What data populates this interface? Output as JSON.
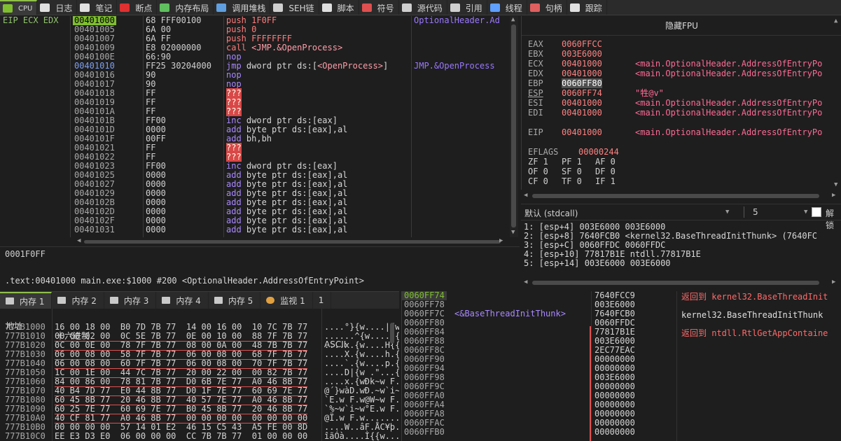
{
  "tabs": [
    {
      "label": "CPU",
      "icon": "cpu-icon",
      "color": "#7fbf2f"
    },
    {
      "label": "日志",
      "icon": "log-icon",
      "color": "#e0e0e0"
    },
    {
      "label": "笔记",
      "icon": "notes-icon",
      "color": "#e0e0e0"
    },
    {
      "label": "断点",
      "icon": "breakpoint-icon",
      "color": "#e03030"
    },
    {
      "label": "内存布局",
      "icon": "memory-map-icon",
      "color": "#5fbf5f"
    },
    {
      "label": "调用堆栈",
      "icon": "call-stack-icon",
      "color": "#5f9fdf"
    },
    {
      "label": "SEH链",
      "icon": "seh-icon",
      "color": "#cfcfcf"
    },
    {
      "label": "脚本",
      "icon": "script-icon",
      "color": "#e0e0e0"
    },
    {
      "label": "符号",
      "icon": "symbol-icon",
      "color": "#df4f4f"
    },
    {
      "label": "源代码",
      "icon": "source-icon",
      "color": "#cfcfcf"
    },
    {
      "label": "引用",
      "icon": "reference-icon",
      "color": "#cfcfcf"
    },
    {
      "label": "线程",
      "icon": "thread-icon",
      "color": "#5f9fff"
    },
    {
      "label": "句柄",
      "icon": "handle-icon",
      "color": "#e05f5f"
    },
    {
      "label": "跟踪",
      "icon": "trace-icon",
      "color": "#e0e0e0"
    }
  ],
  "disasm": {
    "rows": [
      {
        "reg": "EIP ECX EDX",
        "addr": "00401000",
        "bytes": "68 FFF00100",
        "mnem": [
          {
            "t": "push ",
            "c": "kwc"
          },
          {
            "t": "1F0FF",
            "c": "num"
          }
        ],
        "comment": "OptionalHeader.Ad",
        "cur": true
      },
      {
        "addr": "00401005",
        "bytes": "6A 00",
        "mnem": [
          {
            "t": "push ",
            "c": "kwc"
          },
          {
            "t": "0",
            "c": "num"
          }
        ]
      },
      {
        "addr": "00401007",
        "bytes": "6A FF",
        "mnem": [
          {
            "t": "push ",
            "c": "kwc"
          },
          {
            "t": "FFFFFFFF",
            "c": "num"
          }
        ]
      },
      {
        "addr": "00401009",
        "bytes": "E8 02000000",
        "mnem": [
          {
            "t": "call ",
            "c": "kwc"
          },
          {
            "t": "<JMP.&OpenProcess>",
            "c": "jt"
          }
        ]
      },
      {
        "addr": "0040100E",
        "bytes": "66:90",
        "mnem": [
          {
            "t": "nop",
            "c": "kw"
          }
        ]
      },
      {
        "addr": "00401010",
        "bytes": "FF25 30204000",
        "mnem": [
          {
            "t": "jmp ",
            "c": "kw"
          },
          {
            "t": "dword ptr ds:[",
            "c": "reg"
          },
          {
            "t": "<OpenProcess>",
            "c": "jt"
          },
          {
            "t": "]",
            "c": "reg"
          }
        ],
        "comment": "JMP.&OpenProcess",
        "lbl": true
      },
      {
        "addr": "00401016",
        "bytes": "90",
        "mnem": [
          {
            "t": "nop",
            "c": "kw"
          }
        ]
      },
      {
        "addr": "00401017",
        "bytes": "90",
        "mnem": [
          {
            "t": "nop",
            "c": "kw"
          }
        ]
      },
      {
        "addr": "00401018",
        "bytes": "FF",
        "mnem": [
          {
            "t": "???",
            "c": "bad"
          }
        ]
      },
      {
        "addr": "00401019",
        "bytes": "FF",
        "mnem": [
          {
            "t": "???",
            "c": "bad"
          }
        ]
      },
      {
        "addr": "0040101A",
        "bytes": "FF",
        "mnem": [
          {
            "t": "???",
            "c": "bad"
          }
        ]
      },
      {
        "addr": "0040101B",
        "bytes": "FF00",
        "mnem": [
          {
            "t": "inc ",
            "c": "kw"
          },
          {
            "t": "dword ptr ds:[eax]",
            "c": "reg"
          }
        ]
      },
      {
        "addr": "0040101D",
        "bytes": "0000",
        "mnem": [
          {
            "t": "add ",
            "c": "kw"
          },
          {
            "t": "byte ptr ds:[eax],al",
            "c": "reg"
          }
        ]
      },
      {
        "addr": "0040101F",
        "bytes": "00FF",
        "mnem": [
          {
            "t": "add ",
            "c": "kw"
          },
          {
            "t": "bh,bh",
            "c": "reg"
          }
        ]
      },
      {
        "addr": "00401021",
        "bytes": "FF",
        "mnem": [
          {
            "t": "???",
            "c": "bad"
          }
        ]
      },
      {
        "addr": "00401022",
        "bytes": "FF",
        "mnem": [
          {
            "t": "???",
            "c": "bad"
          }
        ]
      },
      {
        "addr": "00401023",
        "bytes": "FF00",
        "mnem": [
          {
            "t": "inc ",
            "c": "kw"
          },
          {
            "t": "dword ptr ds:[eax]",
            "c": "reg"
          }
        ]
      },
      {
        "addr": "00401025",
        "bytes": "0000",
        "mnem": [
          {
            "t": "add ",
            "c": "kw"
          },
          {
            "t": "byte ptr ds:[eax],al",
            "c": "reg"
          }
        ]
      },
      {
        "addr": "00401027",
        "bytes": "0000",
        "mnem": [
          {
            "t": "add ",
            "c": "kw"
          },
          {
            "t": "byte ptr ds:[eax],al",
            "c": "reg"
          }
        ]
      },
      {
        "addr": "00401029",
        "bytes": "0000",
        "mnem": [
          {
            "t": "add ",
            "c": "kw"
          },
          {
            "t": "byte ptr ds:[eax],al",
            "c": "reg"
          }
        ]
      },
      {
        "addr": "0040102B",
        "bytes": "0000",
        "mnem": [
          {
            "t": "add ",
            "c": "kw"
          },
          {
            "t": "byte ptr ds:[eax],al",
            "c": "reg"
          }
        ]
      },
      {
        "addr": "0040102D",
        "bytes": "0000",
        "mnem": [
          {
            "t": "add ",
            "c": "kw"
          },
          {
            "t": "byte ptr ds:[eax],al",
            "c": "reg"
          }
        ]
      },
      {
        "addr": "0040102F",
        "bytes": "0000",
        "mnem": [
          {
            "t": "add ",
            "c": "kw"
          },
          {
            "t": "byte ptr ds:[eax],al",
            "c": "reg"
          }
        ]
      },
      {
        "addr": "00401031",
        "bytes": "0000",
        "mnem": [
          {
            "t": "add ",
            "c": "kw"
          },
          {
            "t": "byte ptr ds:[eax],al",
            "c": "reg"
          }
        ]
      }
    ]
  },
  "info": {
    "value": "0001F0FF",
    "location": ".text:00401000 main.exe:$1000 #200 <OptionalHeader.AddressOfEntryPoint>"
  },
  "registers": {
    "fpu_button": "隐藏FPU",
    "rows": [
      {
        "name": "EAX",
        "value": "0060FFCC",
        "comment": ""
      },
      {
        "name": "EBX",
        "value": "003E6000",
        "comment": ""
      },
      {
        "name": "ECX",
        "value": "00401000",
        "comment": "<main.OptionalHeader.AddressOfEntryPo"
      },
      {
        "name": "EDX",
        "value": "00401000",
        "comment": "<main.OptionalHeader.AddressOfEntryPo"
      },
      {
        "name": "EBP",
        "value": "0060FF80",
        "comment": "",
        "hl": true
      },
      {
        "name": "ESP",
        "value": "0060FF74",
        "comment": "\"牲@v\"",
        "ul": true
      },
      {
        "name": "ESI",
        "value": "00401000",
        "comment": "<main.OptionalHeader.AddressOfEntryPo"
      },
      {
        "name": "EDI",
        "value": "00401000",
        "comment": "<main.OptionalHeader.AddressOfEntryPo"
      },
      {
        "name": "",
        "value": "",
        "comment": ""
      },
      {
        "name": "EIP",
        "value": "00401000",
        "comment": "<main.OptionalHeader.AddressOfEntryPo"
      },
      {
        "name": "",
        "value": "",
        "comment": ""
      },
      {
        "name": "EFLAGS",
        "value": "00000244",
        "comment": "",
        "wide": true
      }
    ],
    "flags": [
      [
        "ZF 1",
        "PF 1",
        "AF 0"
      ],
      [
        "OF 0",
        "SF 0",
        "DF 0"
      ],
      [
        "CF 0",
        "TF 0",
        "IF 1"
      ]
    ]
  },
  "callconv": {
    "selected": "默认 (stdcall)",
    "count": "5",
    "checkbox_label": "解锁"
  },
  "args": [
    "1: [esp+4] 003E6000 003E6000",
    "2: [esp+8] 7640FCB0 <kernel32.BaseThreadInitThunk> (7640FC",
    "3: [esp+C] 0060FFDC 0060FFDC",
    "4: [esp+10] 77817B1E ntdll.77817B1E",
    "5: [esp+14] 003E6000 003E6000"
  ],
  "dumptabs": [
    {
      "label": "内存 1",
      "active": true
    },
    {
      "label": "内存 2"
    },
    {
      "label": "内存 3"
    },
    {
      "label": "内存 4"
    },
    {
      "label": "内存 5"
    },
    {
      "label": "监视 1",
      "icon": "watch-icon"
    }
  ],
  "dumptab_more": "1",
  "dump": {
    "header": {
      "addr": "地址",
      "hex": "十六进制",
      "ascii": "ASCII"
    },
    "rows": [
      {
        "addr": "777B1000",
        "hex": "16 00 18 00  B0 7D 7B 77  14 00 16 00  10 7C 7B 77",
        "ascii": "....°}{w....|{w"
      },
      {
        "addr": "777B1010",
        "hex": "00 00 02 00  0C 5E 7B 77  0E 00 10 00  88 7F 7B 77",
        "ascii": "......^{w.....{w"
      },
      {
        "addr": "777B1020",
        "hex": "0C 00 0E 00  78 7F 7B 77  08 00 0A 00  48 7B 7B 77",
        "ascii": "....x.{w....H{{w"
      },
      {
        "addr": "777B1030",
        "hex": "06 00 08 00  58 7F 7B 77  06 00 08 00  68 7F 7B 77",
        "ascii": "....X.{w....h.{w"
      },
      {
        "addr": "777B1040",
        "hex": "06 00 08 00  60 7F 7B 77  06 00 08 00  70 7F 7B 77",
        "ascii": "....`.{w....p.{w"
      },
      {
        "addr": "777B1050",
        "hex": "1C 00 1E 00  44 7C 7B 77  20 00 22 00  00 82 7B 77",
        "ascii": "....D|{w .\"...{w"
      },
      {
        "addr": "777B1060",
        "hex": "84 00 86 00  78 81 7B 77  D0 6B 7E 77  A0 46 8B 77",
        "ascii": "....x.{wÐk~w F.w"
      },
      {
        "addr": "777B1070",
        "hex": "40 B4 7D 77  E0 44 8B 77  D0 1F 7E 77  60 69 7E 77",
        "ascii": "@´}wàD.wÐ.~w`i~w"
      },
      {
        "addr": "777B1080",
        "hex": "60 45 8B 77  20 46 8B 77  40 57 7E 77  A0 46 8B 77",
        "ascii": "`E.w F.w@W~w F.w"
      },
      {
        "addr": "777B1090",
        "hex": "60 25 7E 77  60 69 7E 77  B0 45 8B 77  20 46 8B 77",
        "ascii": "`%~w`i~w°E.w F.w"
      },
      {
        "addr": "777B10A0",
        "hex": "40 CF 81 77  A0 46 8B 77  00 00 00 00  00 00 00 00",
        "ascii": "@Ï.w F.w........"
      },
      {
        "addr": "777B10B0",
        "hex": "00 00 00 00  57 14 01 E2  46 15 C5 43  A5 FE 00 8D",
        "ascii": "....W..âF.ÅC¥þ.."
      },
      {
        "addr": "777B10C0",
        "hex": "EE E3 D3 E0  06 00 00 00  CC 7B 7B 77  01 00 00 00",
        "ascii": "îãÓà....Ì{{w...."
      }
    ]
  },
  "stack": {
    "rows": [
      {
        "addr": "0060FF74",
        "comment": "",
        "value": "7640FCC9",
        "top": true
      },
      {
        "addr": "0060FF78",
        "comment": "",
        "value": "003E6000"
      },
      {
        "addr": "0060FF7C",
        "comment": "<&BaseThreadInitThunk>",
        "value": "7640FCB0"
      },
      {
        "addr": "0060FF80",
        "comment": "",
        "value": "0060FFDC"
      },
      {
        "addr": "0060FF84",
        "comment": "",
        "value": "77817B1E"
      },
      {
        "addr": "0060FF88",
        "comment": "",
        "value": "003E6000"
      },
      {
        "addr": "0060FF8C",
        "comment": "",
        "value": "2EC77EAC"
      },
      {
        "addr": "0060FF90",
        "comment": "",
        "value": "00000000"
      },
      {
        "addr": "0060FF94",
        "comment": "",
        "value": "00000000"
      },
      {
        "addr": "0060FF98",
        "comment": "",
        "value": "003E6000"
      },
      {
        "addr": "0060FF9C",
        "comment": "",
        "value": "00000000"
      },
      {
        "addr": "0060FFA0",
        "comment": "",
        "value": "00000000"
      },
      {
        "addr": "0060FFA4",
        "comment": "",
        "value": "00000000"
      },
      {
        "addr": "0060FFA8",
        "comment": "",
        "value": "00000000"
      },
      {
        "addr": "0060FFAC",
        "comment": "",
        "value": "00000000"
      },
      {
        "addr": "0060FFB0",
        "comment": "",
        "value": "00000000"
      }
    ],
    "notes": [
      {
        "text": "返回到 kernel32.BaseThreadInit",
        "red": true
      },
      {
        "text": "kernel32.BaseThreadInitThunk",
        "red": false
      },
      {
        "text": "返回到 ntdll.RtlGetAppContaine",
        "red": true
      }
    ]
  }
}
